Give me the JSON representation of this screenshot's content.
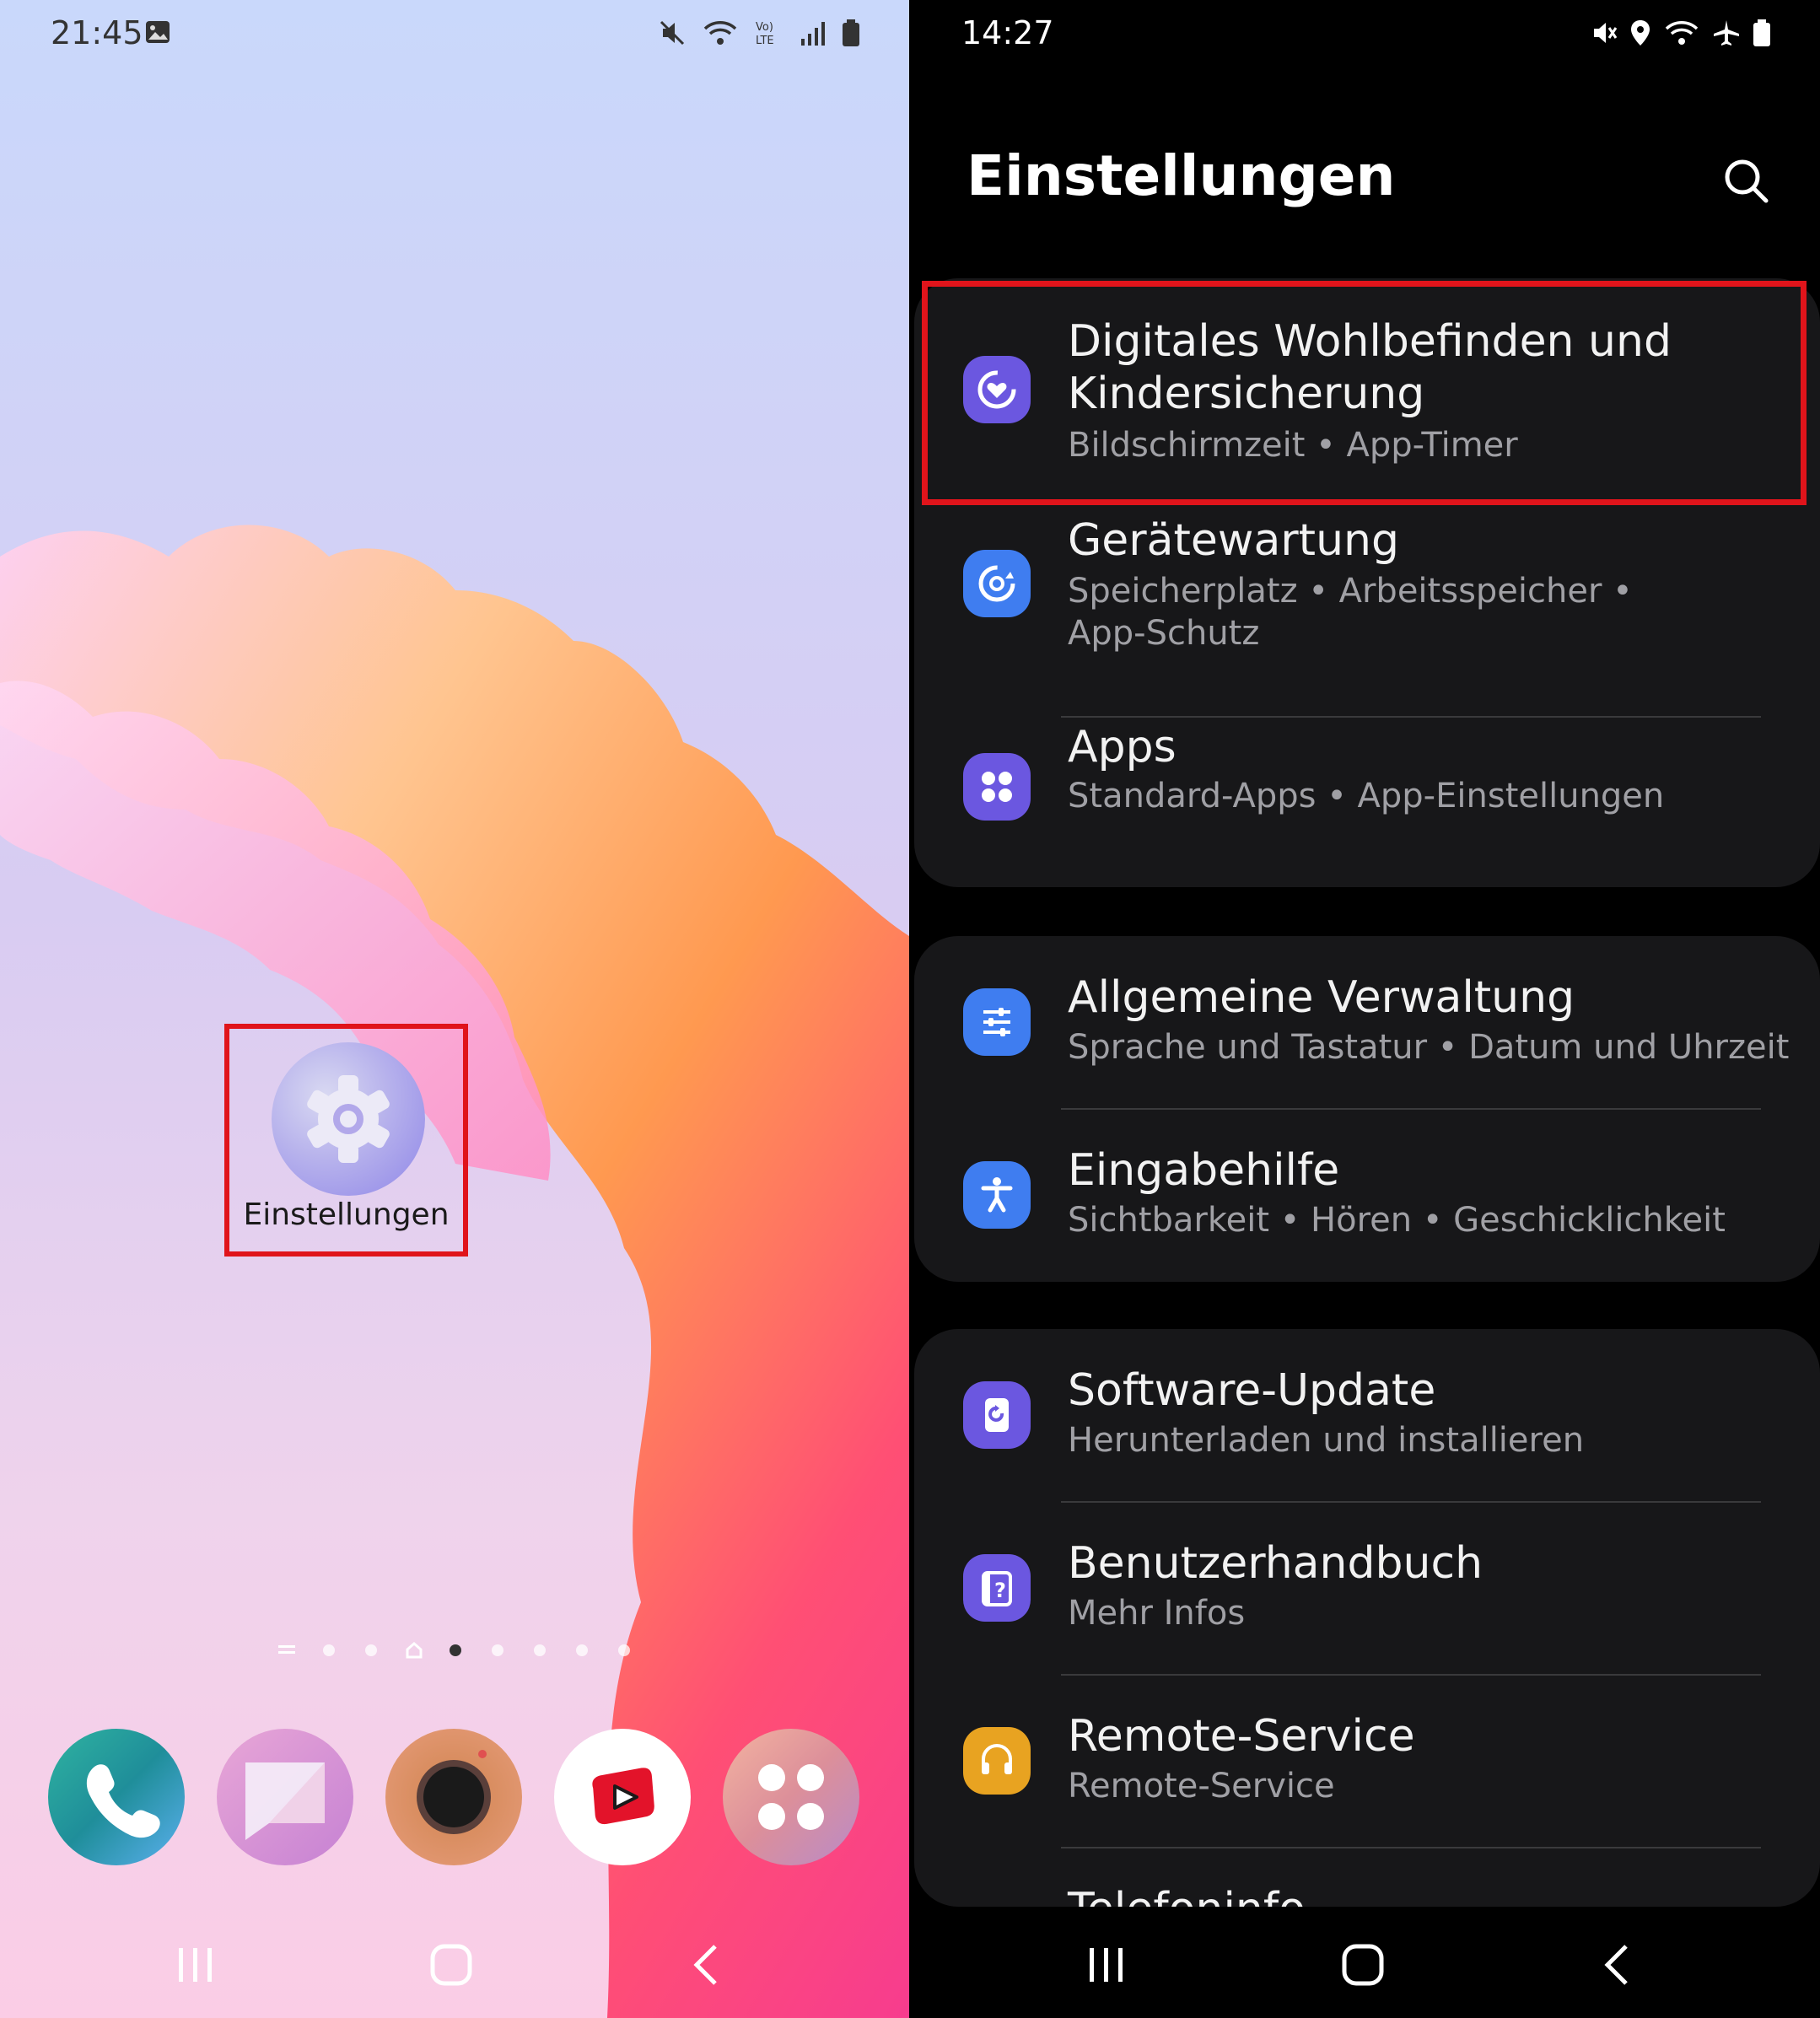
{
  "left_screen": {
    "status_bar": {
      "time": "21:45",
      "icons": [
        "gallery-icon",
        "mute-icon",
        "wifi-icon",
        "volte-icon",
        "signal-icon",
        "battery-icon"
      ]
    },
    "highlighted_app": {
      "label": "Einstellungen",
      "icon": "gear-icon"
    },
    "dock_apps": [
      "phone-icon",
      "messages-icon",
      "camera-icon",
      "youtube-icon",
      "apps-folder-icon"
    ],
    "pager": {
      "pages": 8,
      "current_index": 4
    },
    "highlight_color": "#e0141b"
  },
  "right_screen": {
    "status_bar": {
      "time": "14:27",
      "icons": [
        "mute-icon",
        "location-icon",
        "wifi-icon",
        "airplane-icon",
        "battery-icon"
      ]
    },
    "title": "Einstellungen",
    "search_icon": "search-icon",
    "groups": [
      {
        "items": [
          {
            "title_line1": "Digitales Wohlbefinden und",
            "title_line2": "Kindersicherung",
            "subtitle": "Bildschirmzeit  •  App-Timer",
            "icon": "wellbeing-icon",
            "color": "#6b57e0",
            "highlighted": true
          },
          {
            "title": "Gerätewartung",
            "subtitle_line1": "Speicherplatz  •  Arbeitsspeicher  •",
            "subtitle_line2": "App-Schutz",
            "icon": "device-care-icon",
            "color": "#3f7df0"
          },
          {
            "title": "Apps",
            "subtitle": "Standard-Apps  •  App-Einstellungen",
            "icon": "apps-icon",
            "color": "#6b57e0"
          }
        ]
      },
      {
        "items": [
          {
            "title": "Allgemeine Verwaltung",
            "subtitle": "Sprache und Tastatur  •  Datum und Uhrzeit",
            "icon": "sliders-icon",
            "color": "#3f7df0"
          },
          {
            "title": "Eingabehilfe",
            "subtitle": "Sichtbarkeit  •  Hören  •  Geschicklichkeit",
            "icon": "accessibility-icon",
            "color": "#3f7df0"
          }
        ]
      },
      {
        "items": [
          {
            "title": "Software-Update",
            "subtitle": "Herunterladen und installieren",
            "icon": "update-icon",
            "color": "#6b57e0"
          },
          {
            "title": "Benutzerhandbuch",
            "subtitle": "Mehr Infos",
            "icon": "manual-icon",
            "color": "#6b57e0"
          },
          {
            "title": "Remote-Service",
            "subtitle": "Remote-Service",
            "icon": "headset-icon",
            "color": "#e8a321"
          },
          {
            "title": "Telefoninfo"
          }
        ]
      }
    ]
  }
}
